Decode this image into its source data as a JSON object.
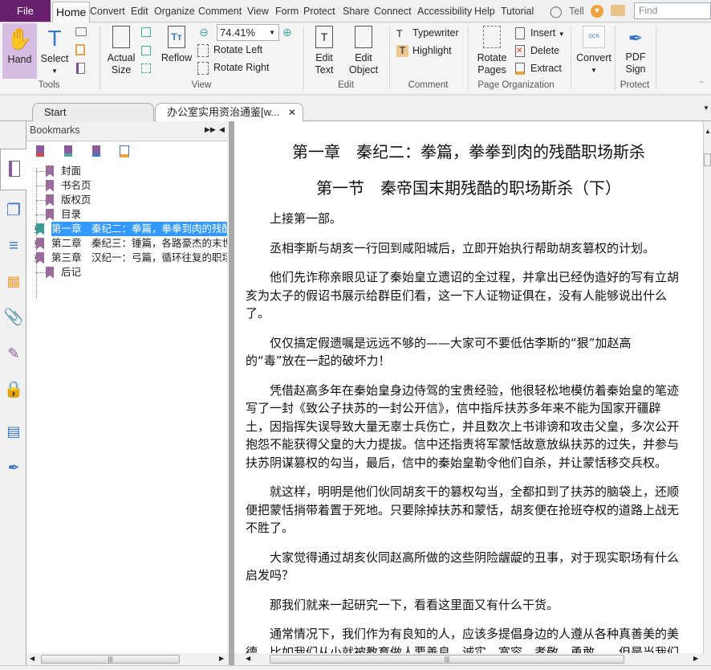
{
  "menu": {
    "file": "File",
    "home": "Home",
    "items": [
      "Convert",
      "Edit",
      "Organize",
      "Comment",
      "View",
      "Form",
      "Protect",
      "Share",
      "Connect",
      "Accessibility",
      "Help",
      "Tutorial"
    ],
    "tell": "Tell",
    "find_placeholder": "Find"
  },
  "ribbon": {
    "tools": {
      "hand": "Hand",
      "select": "Select",
      "label": "Tools"
    },
    "view": {
      "actual_size": "Actual Size",
      "reflow": "Reflow",
      "zoom": "74.41%",
      "rotate_left": "Rotate Left",
      "rotate_right": "Rotate Right",
      "label": "View"
    },
    "edit": {
      "edit_text": "Edit Text",
      "edit_object": "Edit Object",
      "label": "Edit"
    },
    "comment": {
      "typewriter": "Typewriter",
      "highlight": "Highlight",
      "label": "Comment"
    },
    "page_org": {
      "rotate_pages": "Rotate Pages",
      "insert": "Insert",
      "delete": "Delete",
      "extract": "Extract",
      "label": "Page Organization"
    },
    "convert": {
      "convert": "Convert"
    },
    "protect": {
      "pdf_sign": "PDF Sign",
      "label": "Protect"
    }
  },
  "tabs": [
    {
      "label": "Start"
    },
    {
      "label": "办公室实用资治通鉴[w..."
    }
  ],
  "bookmarks": {
    "title": "Bookmarks",
    "items": [
      {
        "label": "封面",
        "expandable": false,
        "selected": false
      },
      {
        "label": "书名页",
        "expandable": false,
        "selected": false
      },
      {
        "label": "版权页",
        "expandable": false,
        "selected": false
      },
      {
        "label": "目录",
        "expandable": false,
        "selected": false
      },
      {
        "label": "第一章　秦纪二：拳篇，拳拳到肉的残酷职场斯杀",
        "expandable": true,
        "selected": true
      },
      {
        "label": "第二章　秦纪三：锤篇，各路豪杰的末世",
        "expandable": true,
        "selected": false
      },
      {
        "label": "第三章　汉纪一：弓篇，循环往复的职场",
        "expandable": true,
        "selected": false
      },
      {
        "label": "后记",
        "expandable": false,
        "selected": false
      }
    ]
  },
  "document": {
    "title1": "第一章　秦纪二：拳篇，拳拳到肉的残酷职场斯杀",
    "title2": "第一节　秦帝国末期残酷的职场斯杀（下）",
    "paragraphs": [
      "上接第一部。",
      "丞相李斯与胡亥一行回到咸阳城后，立即开始执行帮助胡亥篡权的计划。",
      "他们先诈称亲眼见证了秦始皇立遗诏的全过程，并拿出已经伪造好的写有立胡亥为太子的假诏书展示给群臣们看，这一下人证物证俱在，没有人能够说出什么了。",
      "仅仅搞定假遗嘱是远远不够的——大家可不要低估李斯的“狠”加赵高的“毒”放在一起的破坏力！",
      "凭借赵高多年在秦始皇身边侍驾的宝贵经验，他很轻松地模仿着秦始皇的笔迹写了一封《致公子扶苏的一封公开信》，信中指斥扶苏多年来不能为国家开疆辟土，因指挥失误导致大量无辜士兵伤亡，并且数次上书诽谤和攻击父皇，多次公开抱怨不能获得父皇的大力提拔。信中还指责将军蒙恬故意放纵扶苏的过失，并参与扶苏阴谋篡权的勾当，最后，信中的秦始皇勒令他们自杀，并让蒙恬移交兵权。",
      "就这样，明明是他们伙同胡亥干的篡权勾当，全都扣到了扶苏的脑袋上，还顺便把蒙恬捎带着置于死地。只要除掉扶苏和蒙恬，胡亥便在抢班夺权的道路上战无不胜了。",
      "大家觉得通过胡亥伙同赵高所做的这些阴险龌龊的丑事，对于现实职场有什么启发吗？",
      "那我们就来一起研究一下，看看这里面又有什么干货。",
      "通常情况下，我们作为有良知的人，应该多提倡身边的人遵从各种真善美的美德，比如我们从小就被教育做人要善良、诚实、宽容、孝敬、勇敢……但是当我们"
    ]
  }
}
